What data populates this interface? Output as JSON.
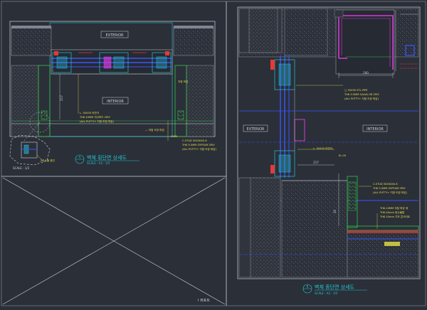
{
  "left_detail": {
    "exterior_label": "EXTERIOR",
    "interior_label": "INTERIOR",
    "dim_217": "217",
    "note_void": "VOID",
    "note_stud": "C-STUD 50X30X0.8",
    "note_gypsum": "THK 9.5MM GYPSUM 2PLY",
    "note_putty": "(ALL PUTTY+ 지정 도장 마감)",
    "note_left1": "L- 30X30 아연각",
    "note_left2": "THK.10MM 석고보드 2PLY",
    "note_left3": "(ALL PUTTY+ 지정 도장 마감)",
    "note_right1": "지정 마감",
    "note_right2": "— 지정 도장 마감",
    "detail_note": "그라스울 충진",
    "scale_small": "SCALE : 1/2",
    "title": "벽체 횡단면 상세도",
    "title_scale": "SCALE : A3 - 1/5",
    "title_num": "A"
  },
  "right_detail": {
    "exterior_label": "EXTERIOR",
    "interior_label": "INTERIOR",
    "dim_200": "200",
    "dim_217": "217",
    "dim_20": "20",
    "note_pipe1": "□ 50X30 STL PIPE",
    "note_pipe2": "THK 9.5MM GALVA OR 2PLY",
    "note_pipe3": "(ALL PUTTY+ 지정 도장 마감)",
    "note_angle": "L- 30X30 아연각",
    "note_elev": "EL.00",
    "note_stud1": "C-STUD 50X30X0.8",
    "note_stud2": "THK 9.5MM GYPSUM 2PLY",
    "note_stud3": "(ALL PUTTY+ 지정 도장 마감)",
    "note_floor1": "THK.10MM 지정 마감 재",
    "note_floor2": "THK.40mm 방수몰탈",
    "note_floor3": "THK.10mm 기초 콘크리트",
    "title": "벽체 종단면 상세도",
    "title_scale": "SCALE : A3 - 1/5",
    "title_num": "B"
  },
  "bottom_label": "I 뷰포트",
  "colors": {
    "background": "#2b2f38",
    "frame": "#cfd4dc",
    "cyan": "#22c7d3",
    "green": "#35c24a",
    "blue": "#3a55ff",
    "magenta": "#d63bd8",
    "red": "#e43a3a",
    "yellow": "#e8e04a"
  }
}
